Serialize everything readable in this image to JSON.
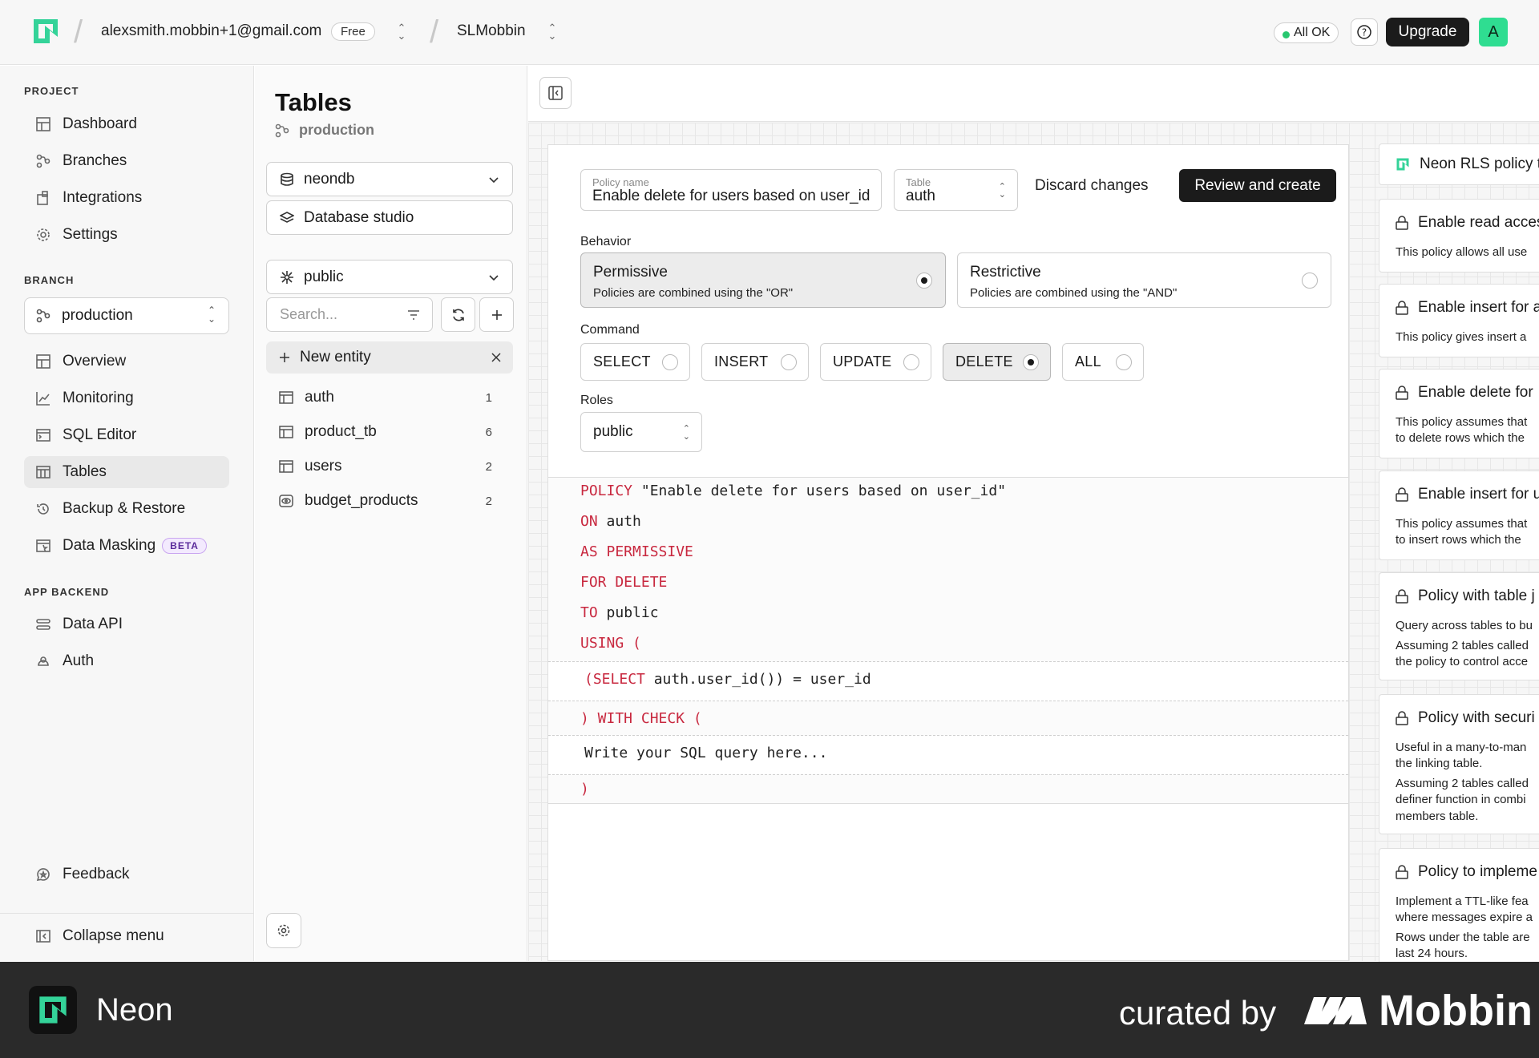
{
  "topbar": {
    "account_email": "alexsmith.mobbin+1@gmail.com",
    "plan_badge": "Free",
    "project_name": "SLMobbin",
    "status": "All OK",
    "upgrade_label": "Upgrade",
    "avatar_initial": "A"
  },
  "sidebar": {
    "project_label": "PROJECT",
    "project_items": [
      {
        "label": "Dashboard",
        "icon": "dashboard-icon"
      },
      {
        "label": "Branches",
        "icon": "branches-icon"
      },
      {
        "label": "Integrations",
        "icon": "integrations-icon"
      },
      {
        "label": "Settings",
        "icon": "gear-icon"
      }
    ],
    "branch_label": "BRANCH",
    "branch_selected": "production",
    "branch_items": [
      {
        "label": "Overview",
        "icon": "overview-icon"
      },
      {
        "label": "Monitoring",
        "icon": "monitoring-icon"
      },
      {
        "label": "SQL Editor",
        "icon": "sql-editor-icon"
      },
      {
        "label": "Tables",
        "icon": "table-icon",
        "active": true
      },
      {
        "label": "Backup & Restore",
        "icon": "history-icon"
      },
      {
        "label": "Data Masking",
        "icon": "masking-icon",
        "badge": "BETA"
      }
    ],
    "app_backend_label": "APP BACKEND",
    "app_backend_items": [
      {
        "label": "Data API",
        "icon": "data-api-icon"
      },
      {
        "label": "Auth",
        "icon": "auth-icon"
      }
    ],
    "feedback_label": "Feedback",
    "collapse_label": "Collapse menu"
  },
  "tables_panel": {
    "title": "Tables",
    "branch": "production",
    "database": "neondb",
    "studio_label": "Database studio",
    "schema": "public",
    "search_placeholder": "Search...",
    "new_entity_label": "New entity",
    "tables": [
      {
        "name": "auth",
        "count": "1",
        "icon": "table-icon"
      },
      {
        "name": "product_tb",
        "count": "6",
        "icon": "table-icon"
      },
      {
        "name": "users",
        "count": "2",
        "icon": "table-icon"
      },
      {
        "name": "budget_products",
        "count": "2",
        "icon": "view-icon"
      }
    ]
  },
  "policy_editor": {
    "policy_name_label": "Policy name",
    "policy_name_value": "Enable delete for users based on user_id",
    "table_label": "Table",
    "table_value": "auth",
    "discard_label": "Discard changes",
    "review_label": "Review and create",
    "behavior_label": "Behavior",
    "behaviors": [
      {
        "title": "Permissive",
        "desc": "Policies are combined using the \"OR\"",
        "selected": true
      },
      {
        "title": "Restrictive",
        "desc": "Policies are combined using the \"AND\"",
        "selected": false
      }
    ],
    "command_label": "Command",
    "commands": [
      {
        "label": "SELECT",
        "selected": false
      },
      {
        "label": "INSERT",
        "selected": false
      },
      {
        "label": "UPDATE",
        "selected": false
      },
      {
        "label": "DELETE",
        "selected": true
      },
      {
        "label": "ALL",
        "selected": false
      }
    ],
    "roles_label": "Roles",
    "roles_value": "public",
    "sql": {
      "line1_kw": "POLICY",
      "line1_tx": "\"Enable delete for users based on user_id\"",
      "line2_kw": "ON",
      "line2_tx": "auth",
      "line3_kw": "AS PERMISSIVE",
      "line4_kw": "FOR DELETE",
      "line5_kw": "TO",
      "line5_tx": "public",
      "line6_kw": "USING (",
      "using_p1": "(",
      "using_kw": "SELECT",
      "using_tx": "auth.user_id())",
      "using_eq": "=",
      "using_tx2": "user_id",
      "check_kw": ") WITH CHECK (",
      "check_placeholder": "Write your SQL query here...",
      "close_kw": ")"
    }
  },
  "templates": {
    "header": "Neon RLS policy te",
    "cards": [
      {
        "title": "Enable read acces",
        "lines": [
          "This policy allows all use"
        ]
      },
      {
        "title": "Enable insert for a",
        "lines": [
          "This policy gives insert a"
        ]
      },
      {
        "title": "Enable delete for",
        "lines": [
          "This policy assumes that",
          "to delete rows which the"
        ]
      },
      {
        "title": "Enable insert for u",
        "lines": [
          "This policy assumes that",
          "to insert rows which the"
        ]
      },
      {
        "title": "Policy with table j",
        "lines": [
          "Query across tables to bu",
          "Assuming 2 tables called",
          "the policy to control acce"
        ]
      },
      {
        "title": "Policy with securi",
        "lines": [
          "Useful in a many-to-man",
          "the linking table.",
          "Assuming 2 tables called",
          "definer function in combi",
          "members table."
        ]
      },
      {
        "title": "Policy to impleme",
        "lines": [
          "Implement a TTL-like fea",
          "where messages expire a",
          "Rows under the table are",
          "last 24 hours."
        ]
      }
    ]
  },
  "footer": {
    "app_name": "Neon",
    "curated_by": "curated by",
    "brand": "Mobbin"
  },
  "colors": {
    "accent_green": "#2fdd91",
    "sql_keyword": "#c8283f",
    "primary_button": "#1b1b1b"
  }
}
